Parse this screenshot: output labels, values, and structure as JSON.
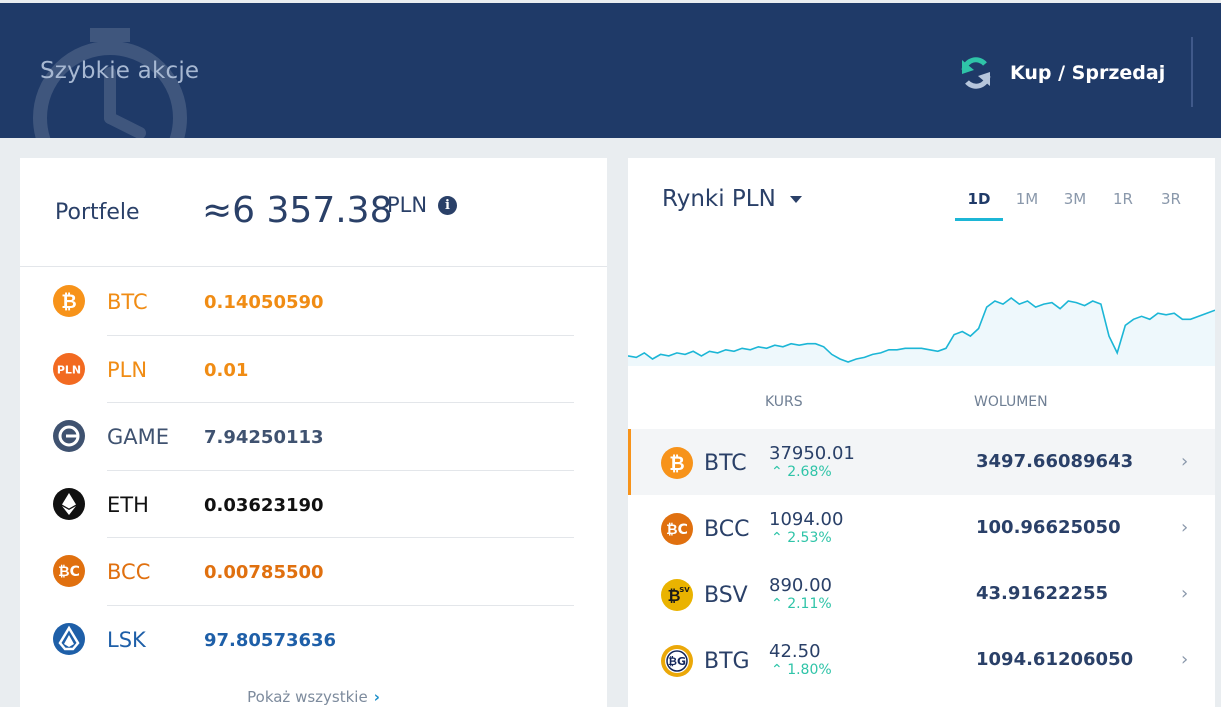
{
  "header": {
    "title": "Szybkie akcje",
    "trade_label": "Kup / Sprzedaj"
  },
  "wallets": {
    "label": "Portfele",
    "total": "≈6 357.38",
    "currency": "PLN",
    "show_all": "Pokaż wszystkie",
    "items": [
      {
        "symbol": "BTC",
        "balance": "0.14050590",
        "color": "#f08c14",
        "icon": "bitcoin-icon"
      },
      {
        "symbol": "PLN",
        "balance": "0.01",
        "color": "#f08c14",
        "icon": "pln-icon"
      },
      {
        "symbol": "GAME",
        "balance": "7.94250113",
        "color": "#3f5270",
        "icon": "gamecredits-icon"
      },
      {
        "symbol": "ETH",
        "balance": "0.03623190",
        "color": "#111111",
        "icon": "ethereum-icon"
      },
      {
        "symbol": "BCC",
        "balance": "0.00785500",
        "color": "#e0700f",
        "icon": "bitcoin-cash-icon"
      },
      {
        "symbol": "LSK",
        "balance": "97.80573636",
        "color": "#1e5fa8",
        "icon": "lisk-icon"
      }
    ]
  },
  "markets": {
    "title": "Rynki PLN",
    "ranges": [
      "1D",
      "1M",
      "3M",
      "1R",
      "3R"
    ],
    "active_range": "1D",
    "col_rate": "KURS",
    "col_volume": "WOLUMEN",
    "rows": [
      {
        "symbol": "BTC",
        "price": "37950.01",
        "change": "2.68%",
        "volume": "3497.66089643",
        "icon": "bitcoin-icon"
      },
      {
        "symbol": "BCC",
        "price": "1094.00",
        "change": "2.53%",
        "volume": "100.96625050",
        "icon": "bitcoin-cash-icon"
      },
      {
        "symbol": "BSV",
        "price": "890.00",
        "change": "2.11%",
        "volume": "43.91622255",
        "icon": "bitcoin-sv-icon"
      },
      {
        "symbol": "BTG",
        "price": "42.50",
        "change": "1.80%",
        "volume": "1094.61206050",
        "icon": "bitcoin-gold-icon"
      }
    ]
  },
  "colors": {
    "header_bg": "#1f3a68",
    "accent_teal": "#1cb6d6",
    "positive": "#2fc4a8",
    "btc_orange": "#f7931a"
  },
  "chart_data": {
    "type": "area",
    "values": [
      10,
      9,
      12,
      8,
      11,
      10,
      12,
      11,
      13,
      10,
      13,
      12,
      14,
      13,
      15,
      14,
      16,
      15,
      17,
      16,
      18,
      17,
      18,
      18,
      16,
      11,
      8,
      6,
      8,
      9,
      11,
      12,
      14,
      14,
      15,
      15,
      15,
      14,
      13,
      15,
      24,
      26,
      23,
      28,
      42,
      46,
      44,
      48,
      44,
      46,
      42,
      44,
      45,
      41,
      46,
      45,
      43,
      46,
      44,
      23,
      12,
      30,
      34,
      36,
      34,
      38,
      37,
      38,
      34,
      34,
      36,
      38,
      40
    ]
  }
}
